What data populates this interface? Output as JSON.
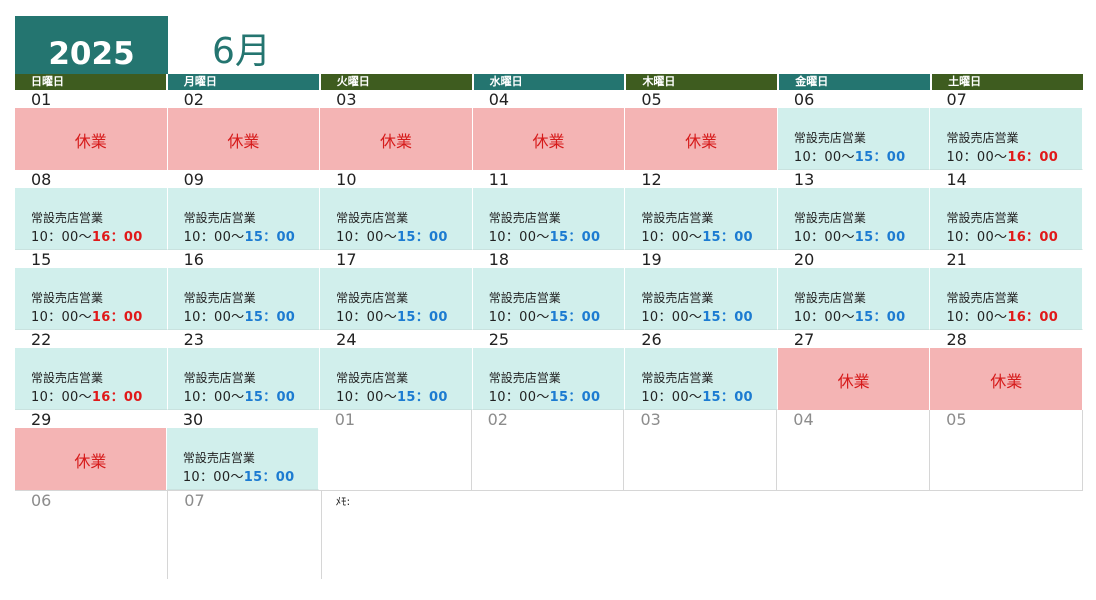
{
  "header": {
    "year": "2025",
    "month": "6月"
  },
  "colors": {
    "header_teal": "#247570",
    "header_olive": "#3e5c1f",
    "closed_bg": "#f4b4b4",
    "open_bg": "#d1efec",
    "end_blue": "#1c7bd1",
    "end_red": "#e01919"
  },
  "weekdays": [
    "日曜日",
    "月曜日",
    "火曜日",
    "水曜日",
    "木曜日",
    "金曜日",
    "土曜日"
  ],
  "weekday_colors": [
    "olive",
    "teal",
    "olive",
    "teal",
    "olive",
    "teal",
    "olive"
  ],
  "status_text": {
    "closed": "休業",
    "open_title": "常設売店営業",
    "open_start": "10：00～"
  },
  "weeks": [
    [
      {
        "d": "01",
        "s": "closed"
      },
      {
        "d": "02",
        "s": "closed"
      },
      {
        "d": "03",
        "s": "closed"
      },
      {
        "d": "04",
        "s": "closed"
      },
      {
        "d": "05",
        "s": "closed"
      },
      {
        "d": "06",
        "s": "open",
        "end": "15：00",
        "c": "blue"
      },
      {
        "d": "07",
        "s": "open",
        "end": "16：00",
        "c": "red"
      }
    ],
    [
      {
        "d": "08",
        "s": "open",
        "end": "16：00",
        "c": "red"
      },
      {
        "d": "09",
        "s": "open",
        "end": "15：00",
        "c": "blue"
      },
      {
        "d": "10",
        "s": "open",
        "end": "15：00",
        "c": "blue"
      },
      {
        "d": "11",
        "s": "open",
        "end": "15：00",
        "c": "blue"
      },
      {
        "d": "12",
        "s": "open",
        "end": "15：00",
        "c": "blue"
      },
      {
        "d": "13",
        "s": "open",
        "end": "15：00",
        "c": "blue"
      },
      {
        "d": "14",
        "s": "open",
        "end": "16：00",
        "c": "red"
      }
    ],
    [
      {
        "d": "15",
        "s": "open",
        "end": "16：00",
        "c": "red"
      },
      {
        "d": "16",
        "s": "open",
        "end": "15：00",
        "c": "blue"
      },
      {
        "d": "17",
        "s": "open",
        "end": "15：00",
        "c": "blue"
      },
      {
        "d": "18",
        "s": "open",
        "end": "15：00",
        "c": "blue"
      },
      {
        "d": "19",
        "s": "open",
        "end": "15：00",
        "c": "blue"
      },
      {
        "d": "20",
        "s": "open",
        "end": "15：00",
        "c": "blue"
      },
      {
        "d": "21",
        "s": "open",
        "end": "16：00",
        "c": "red"
      }
    ],
    [
      {
        "d": "22",
        "s": "open",
        "end": "16：00",
        "c": "red"
      },
      {
        "d": "23",
        "s": "open",
        "end": "15：00",
        "c": "blue"
      },
      {
        "d": "24",
        "s": "open",
        "end": "15：00",
        "c": "blue"
      },
      {
        "d": "25",
        "s": "open",
        "end": "15：00",
        "c": "blue"
      },
      {
        "d": "26",
        "s": "open",
        "end": "15：00",
        "c": "blue"
      },
      {
        "d": "27",
        "s": "closed"
      },
      {
        "d": "28",
        "s": "closed"
      }
    ],
    [
      {
        "d": "29",
        "s": "closed"
      },
      {
        "d": "30",
        "s": "open",
        "end": "15：00",
        "c": "blue"
      },
      {
        "d": "01",
        "other": true
      },
      {
        "d": "02",
        "other": true
      },
      {
        "d": "03",
        "other": true
      },
      {
        "d": "04",
        "other": true
      },
      {
        "d": "05",
        "other": true
      }
    ]
  ],
  "last_row": {
    "days": [
      "06",
      "07"
    ],
    "memo_label": "ﾒﾓ:"
  }
}
